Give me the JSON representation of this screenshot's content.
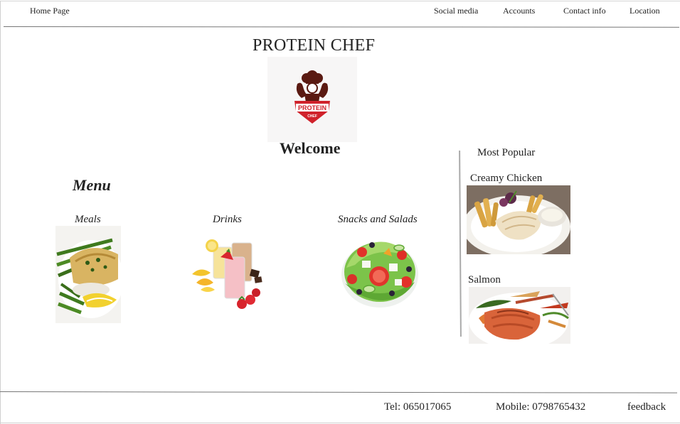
{
  "nav": {
    "home": "Home Page",
    "social": "Social media",
    "accounts": "Accounts",
    "contact": "Contact info",
    "location": "Location"
  },
  "header": {
    "title": "PROTEIN CHEF",
    "logo_text_top": "PROTEIN",
    "logo_text_bottom": "CHEF",
    "welcome": "Welcome"
  },
  "menu": {
    "heading": "Menu",
    "categories": [
      {
        "label": "Meals",
        "image": "fish-with-asparagus"
      },
      {
        "label": "Drinks",
        "image": "fruit-smoothies"
      },
      {
        "label": "Snacks and Salads",
        "image": "greek-salad"
      }
    ]
  },
  "popular": {
    "heading": "Most Popular",
    "items": [
      {
        "label": "Creamy Chicken",
        "image": "chicken-with-fries"
      },
      {
        "label": "Salmon",
        "image": "grilled-salmon"
      }
    ]
  },
  "footer": {
    "tel": "Tel: 065017065",
    "mobile": "Mobile: 0798765432",
    "feedback": "feedback"
  },
  "colors": {
    "logo_red": "#d0222b",
    "logo_dark": "#5a1a12",
    "rule": "#777777"
  }
}
